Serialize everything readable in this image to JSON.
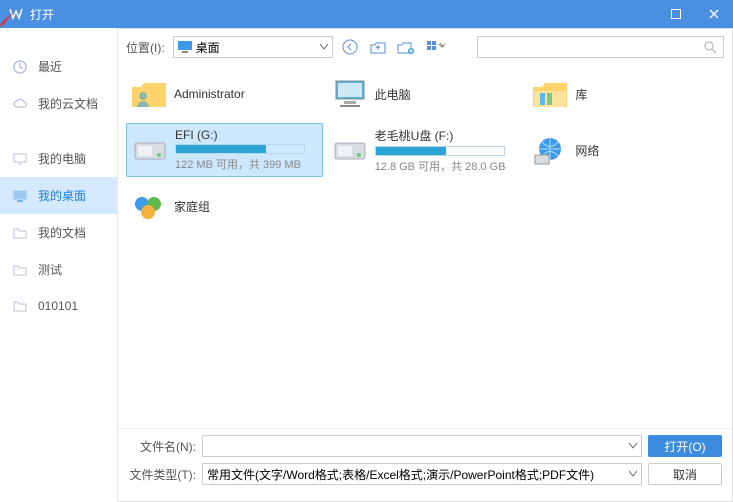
{
  "window": {
    "title": "打开"
  },
  "sidebar": {
    "items": [
      {
        "label": "最近"
      },
      {
        "label": "我的云文档"
      },
      {
        "label": "我的电脑"
      },
      {
        "label": "我的桌面"
      },
      {
        "label": "我的文档"
      },
      {
        "label": "测试"
      },
      {
        "label": "010101"
      }
    ]
  },
  "toolbar": {
    "location_label": "位置(I):",
    "location_value": "桌面",
    "search_placeholder": ""
  },
  "items": {
    "administrator": {
      "name": "Administrator"
    },
    "this_pc": {
      "name": "此电脑"
    },
    "library": {
      "name": "库"
    },
    "efi": {
      "name": "EFI (G:)",
      "sub": "122 MB 可用，共 399 MB",
      "fill_pct": 70
    },
    "udisk": {
      "name": "老毛桃U盘 (F:)",
      "sub": "12.8 GB 可用，共 28.0 GB",
      "fill_pct": 55
    },
    "network": {
      "name": "网络"
    },
    "homegroup": {
      "name": "家庭组"
    }
  },
  "bottom": {
    "filename_label": "文件名(N):",
    "filename_value": "",
    "filetype_label": "文件类型(T):",
    "filetype_value": "常用文件(文字/Word格式;表格/Excel格式;演示/PowerPoint格式;PDF文件)",
    "open_label": "打开(O)",
    "cancel_label": "取消"
  }
}
